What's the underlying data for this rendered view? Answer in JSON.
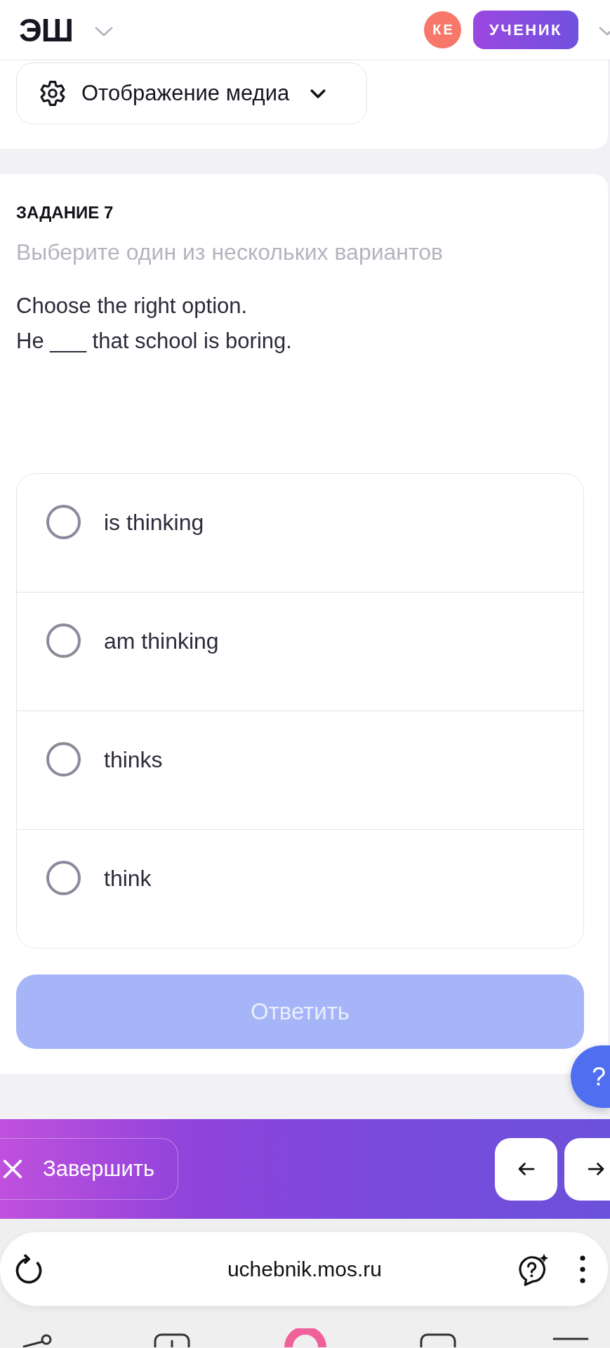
{
  "header": {
    "logo": "ЭШ",
    "avatar": {
      "initials": "КЕ"
    },
    "role_badge": "УЧЕНИК"
  },
  "media_settings": {
    "label": "Отображение медиа"
  },
  "task": {
    "title": "ЗАДАНИЕ 7",
    "instruction": "Выберите один из нескольких вариантов",
    "question": [
      "Choose the right option.",
      "He ___ that school is boring."
    ],
    "options": [
      {
        "label": "is thinking",
        "selected": false
      },
      {
        "label": "am thinking",
        "selected": false
      },
      {
        "label": "thinks",
        "selected": false
      },
      {
        "label": "think",
        "selected": false
      }
    ],
    "submit": {
      "label": "Ответить",
      "disabled": true
    }
  },
  "help_button": {
    "label": "?"
  },
  "bottom_bar": {
    "finish": {
      "label": "Завершить"
    }
  },
  "browser": {
    "url": "uchebnik.mos.ru"
  }
}
